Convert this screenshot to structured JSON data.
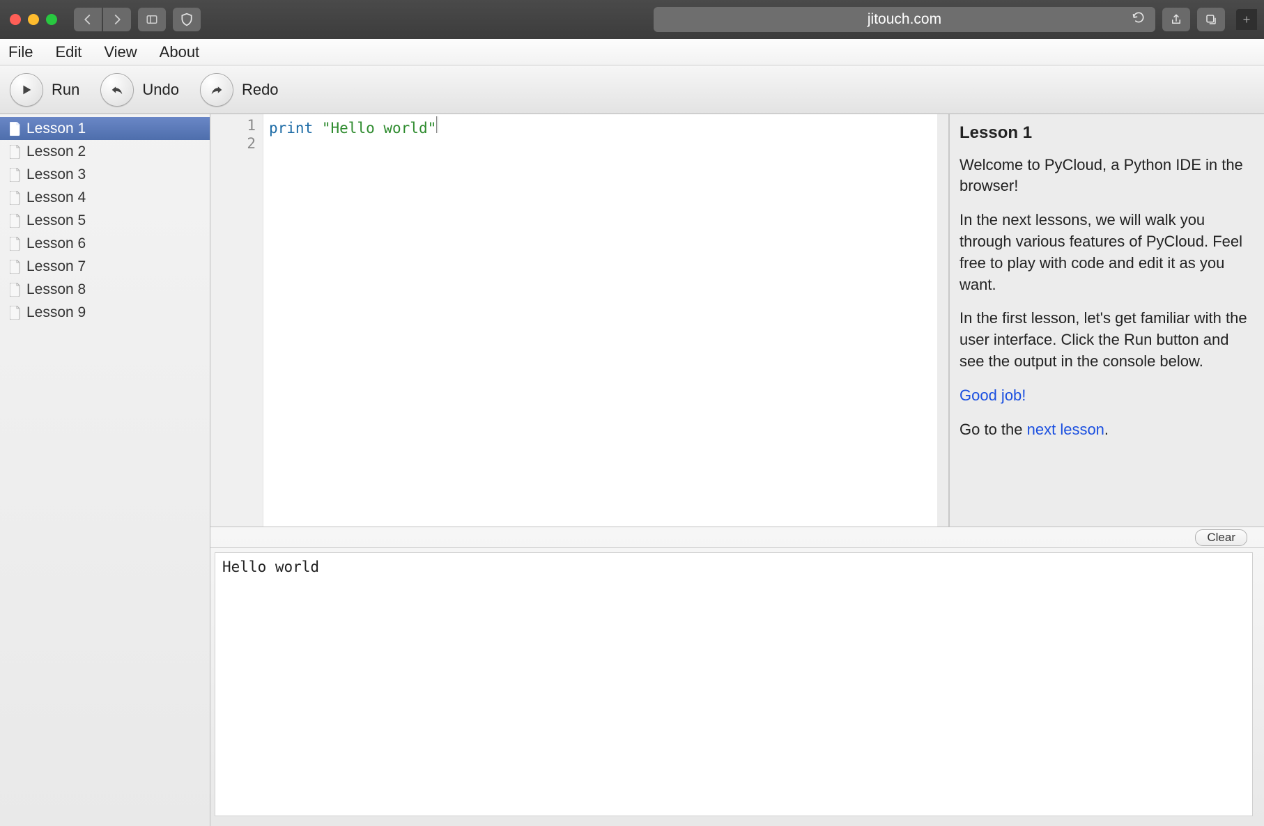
{
  "browser": {
    "url": "jitouch.com"
  },
  "menubar": [
    "File",
    "Edit",
    "View",
    "About"
  ],
  "toolbar": {
    "run_label": "Run",
    "undo_label": "Undo",
    "redo_label": "Redo"
  },
  "sidebar": {
    "items": [
      {
        "label": "Lesson 1",
        "selected": true
      },
      {
        "label": "Lesson 2",
        "selected": false
      },
      {
        "label": "Lesson 3",
        "selected": false
      },
      {
        "label": "Lesson 4",
        "selected": false
      },
      {
        "label": "Lesson 5",
        "selected": false
      },
      {
        "label": "Lesson 6",
        "selected": false
      },
      {
        "label": "Lesson 7",
        "selected": false
      },
      {
        "label": "Lesson 8",
        "selected": false
      },
      {
        "label": "Lesson 9",
        "selected": false
      }
    ]
  },
  "editor": {
    "line_numbers": [
      "1",
      "2"
    ],
    "code_keyword": "print",
    "code_space": " ",
    "code_string": "\"Hello world\""
  },
  "info": {
    "title": "Lesson 1",
    "p1": "Welcome to PyCloud, a Python IDE in the browser!",
    "p2": "In the next lessons, we will walk you through various features of PyCloud. Feel free to play with code and edit it as you want.",
    "p3": "In the first lesson, let's get familiar with the user interface. Click the Run button and see the output in the console below.",
    "good_job": "Good job!",
    "goto_prefix": "Go to the ",
    "goto_link": "next lesson",
    "goto_suffix": "."
  },
  "console": {
    "clear_label": "Clear",
    "output": "Hello world"
  }
}
